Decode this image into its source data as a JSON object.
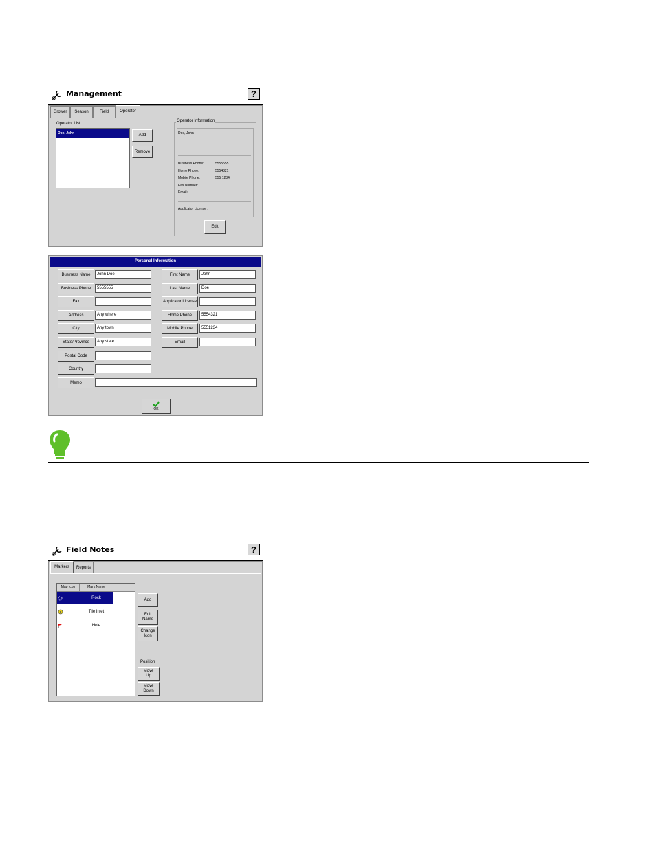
{
  "management": {
    "title": "Management",
    "help": "?",
    "tabs": [
      "Grower",
      "Season",
      "Field",
      "Operator"
    ],
    "operator_list_label": "Operator List",
    "operators": [
      "Doe, John"
    ],
    "add": "Add",
    "remove": "Remove",
    "operator_info_label": "Operator Information",
    "info_name": "Doe, John",
    "info_rows": [
      {
        "label": "Business Phone:",
        "value": "5555555"
      },
      {
        "label": "Home Phone:",
        "value": "5554321"
      },
      {
        "label": "Mobile Phone:",
        "value": "555 1234"
      },
      {
        "label": "Fax Number:",
        "value": ""
      },
      {
        "label": "Email:",
        "value": ""
      }
    ],
    "applicator_license": "Applicator License :",
    "edit": "Edit"
  },
  "personal": {
    "header": "Personal Information",
    "left": [
      {
        "label": "Business Name",
        "value": "John Doe"
      },
      {
        "label": "Business Phone",
        "value": "5555555"
      },
      {
        "label": "Fax",
        "value": ""
      },
      {
        "label": "Address",
        "value": "Any where"
      },
      {
        "label": "City",
        "value": "Any town"
      },
      {
        "label": "State/Province",
        "value": "Any state"
      },
      {
        "label": "Postal Code",
        "value": ""
      },
      {
        "label": "Country",
        "value": ""
      }
    ],
    "right": [
      {
        "label": "First Name",
        "value": "John"
      },
      {
        "label": "Last Name",
        "value": "Doe"
      },
      {
        "label": "Applicator License",
        "value": ""
      },
      {
        "label": "Home Phone",
        "value": "5554321"
      },
      {
        "label": "Mobile Phone",
        "value": "5551234"
      },
      {
        "label": "Email",
        "value": ""
      }
    ],
    "memo_label": "Memo",
    "memo_value": "",
    "ok": "OK"
  },
  "fieldnotes": {
    "title": "Field Notes",
    "help": "?",
    "tabs": [
      "Markers",
      "Reports"
    ],
    "col_icon": "Map Icon",
    "col_name": "Mark Name",
    "marks": [
      "Rock",
      "Tile Inlet",
      "Hole"
    ],
    "add": "Add",
    "edit_name": "Edit Name",
    "change_icon": "Change Icon",
    "position": "Position",
    "move_up": "Move Up",
    "move_down": "Move Down"
  },
  "colors": {
    "selection": "#0a0a8a",
    "panel": "#d4d4d4",
    "bulb": "#5fbf2a"
  }
}
